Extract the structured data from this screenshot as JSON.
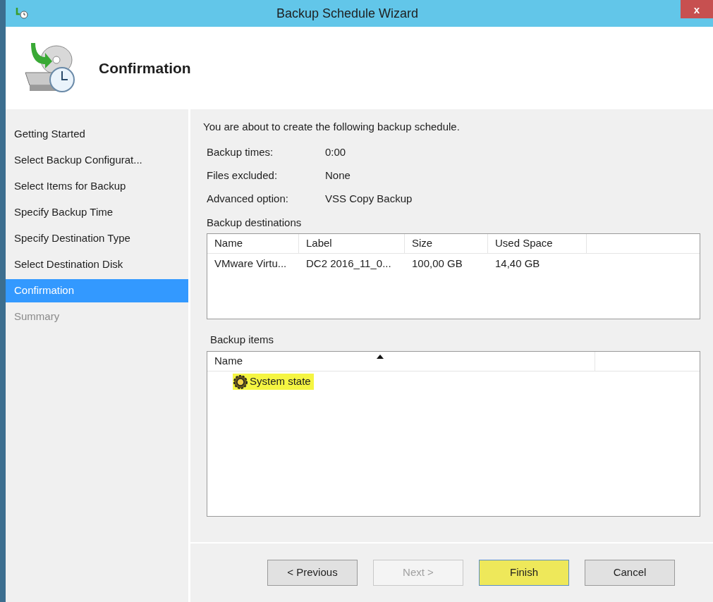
{
  "window": {
    "title": "Backup Schedule Wizard",
    "close": "x"
  },
  "header": {
    "title": "Confirmation"
  },
  "steps": [
    {
      "label": "Getting Started",
      "selected": false,
      "disabled": false
    },
    {
      "label": "Select Backup Configurat...",
      "selected": false,
      "disabled": false
    },
    {
      "label": "Select Items for Backup",
      "selected": false,
      "disabled": false
    },
    {
      "label": "Specify Backup Time",
      "selected": false,
      "disabled": false
    },
    {
      "label": "Specify Destination Type",
      "selected": false,
      "disabled": false
    },
    {
      "label": "Select Destination Disk",
      "selected": false,
      "disabled": false
    },
    {
      "label": "Confirmation",
      "selected": true,
      "disabled": false
    },
    {
      "label": "Summary",
      "selected": false,
      "disabled": true
    }
  ],
  "intro": "You are about to create the following backup schedule.",
  "details": [
    {
      "label": "Backup times:",
      "value": "0:00"
    },
    {
      "label": "Files excluded:",
      "value": "None"
    },
    {
      "label": "Advanced option:",
      "value": "VSS Copy Backup"
    }
  ],
  "destinations": {
    "title": "Backup destinations",
    "columns": [
      "Name",
      "Label",
      "Size",
      "Used Space"
    ],
    "rows": [
      [
        "VMware Virtu...",
        "DC2 2016_11_0...",
        "100,00 GB",
        "14,40 GB"
      ]
    ]
  },
  "items": {
    "title": "Backup items",
    "columns": [
      {
        "label": "Name",
        "sorted": true
      }
    ],
    "rows": [
      {
        "label": "System state",
        "highlighted": true
      }
    ]
  },
  "buttons": [
    {
      "label": "< Previous",
      "disabled": false,
      "highlighted": false
    },
    {
      "label": "Next >",
      "disabled": true,
      "highlighted": false
    },
    {
      "label": "Finish",
      "disabled": false,
      "highlighted": true
    },
    {
      "label": "Cancel",
      "disabled": false,
      "highlighted": false
    }
  ]
}
